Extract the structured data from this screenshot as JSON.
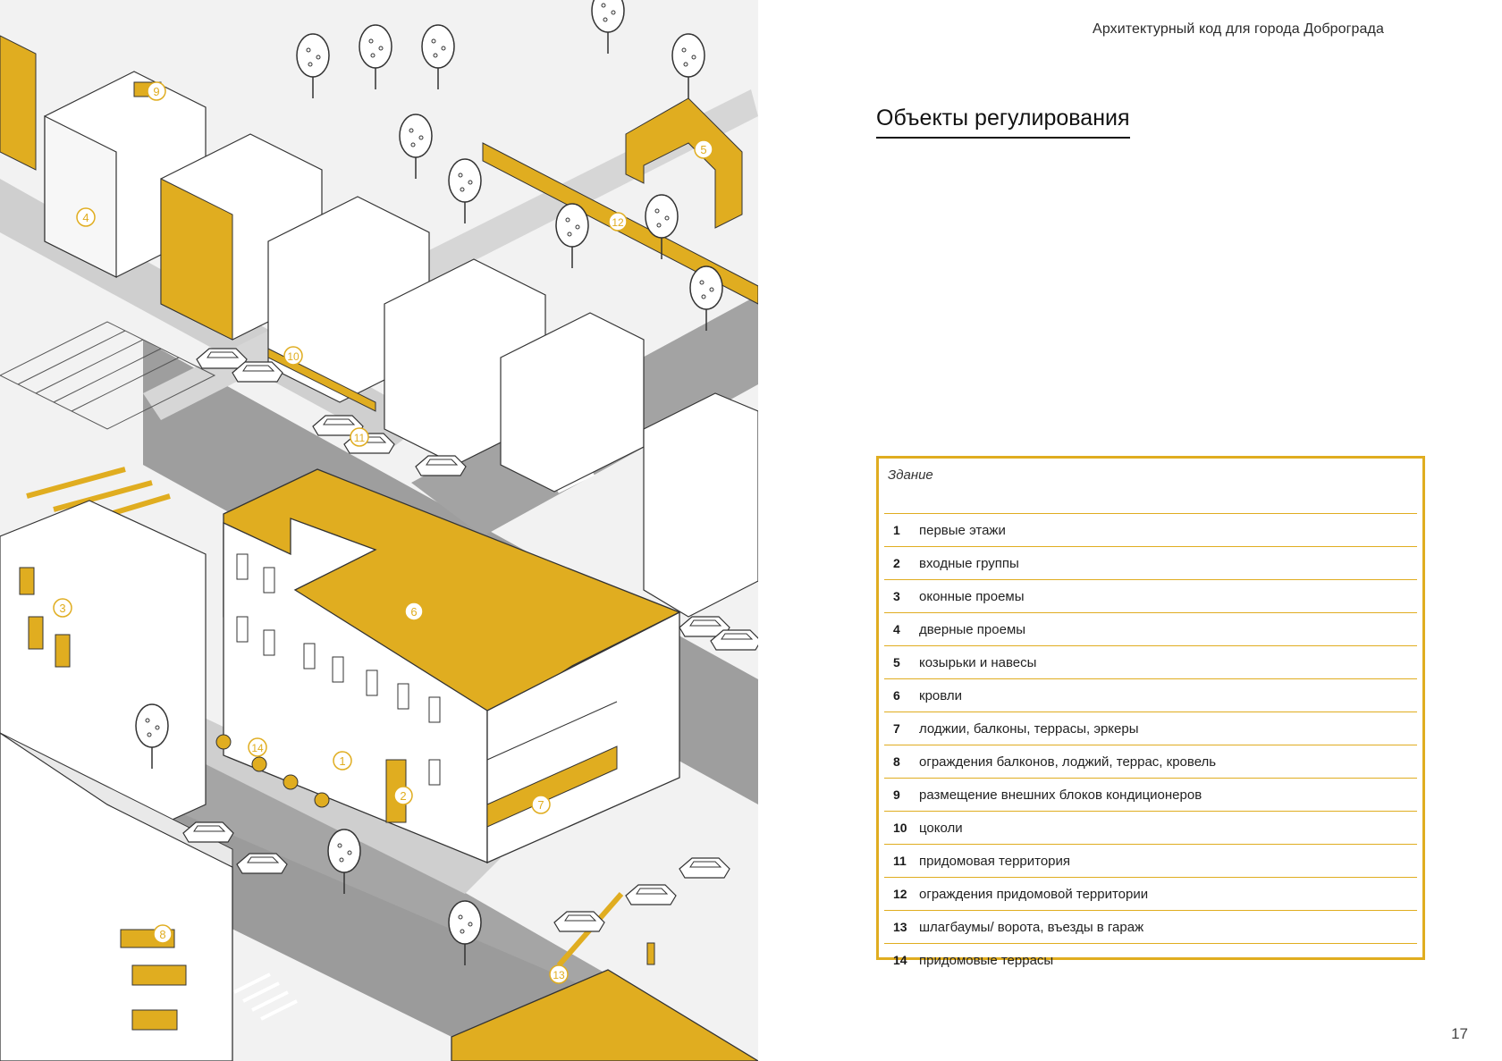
{
  "header": {
    "doc_title": "Архитектурный код для города Доброграда"
  },
  "section": {
    "title": "Объекты регулирования"
  },
  "legend": {
    "heading": "Здание",
    "items": [
      {
        "num": "1",
        "label": "первые этажи"
      },
      {
        "num": "2",
        "label": "входные группы"
      },
      {
        "num": "3",
        "label": "оконные проемы"
      },
      {
        "num": "4",
        "label": "дверные проемы"
      },
      {
        "num": "5",
        "label": "козырьки и навесы"
      },
      {
        "num": "6",
        "label": "кровли"
      },
      {
        "num": "7",
        "label": "лоджии, балконы, террасы, эркеры"
      },
      {
        "num": "8",
        "label": "ограждения балконов, лоджий, террас, кровель"
      },
      {
        "num": "9",
        "label": "размещение внешних блоков кондиционеров"
      },
      {
        "num": "10",
        "label": "цоколи"
      },
      {
        "num": "11",
        "label": "придомовая территория"
      },
      {
        "num": "12",
        "label": "ограждения придомовой территории"
      },
      {
        "num": "13",
        "label": "шлагбаумы/ ворота, въезды в гараж"
      },
      {
        "num": "14",
        "label": "придомовые террасы"
      }
    ]
  },
  "illustration": {
    "accent_color": "#e0ad20",
    "markers": [
      "1",
      "2",
      "3",
      "4",
      "5",
      "6",
      "7",
      "8",
      "9",
      "10",
      "11",
      "12",
      "13",
      "14"
    ]
  },
  "footer": {
    "page_number": "17"
  }
}
